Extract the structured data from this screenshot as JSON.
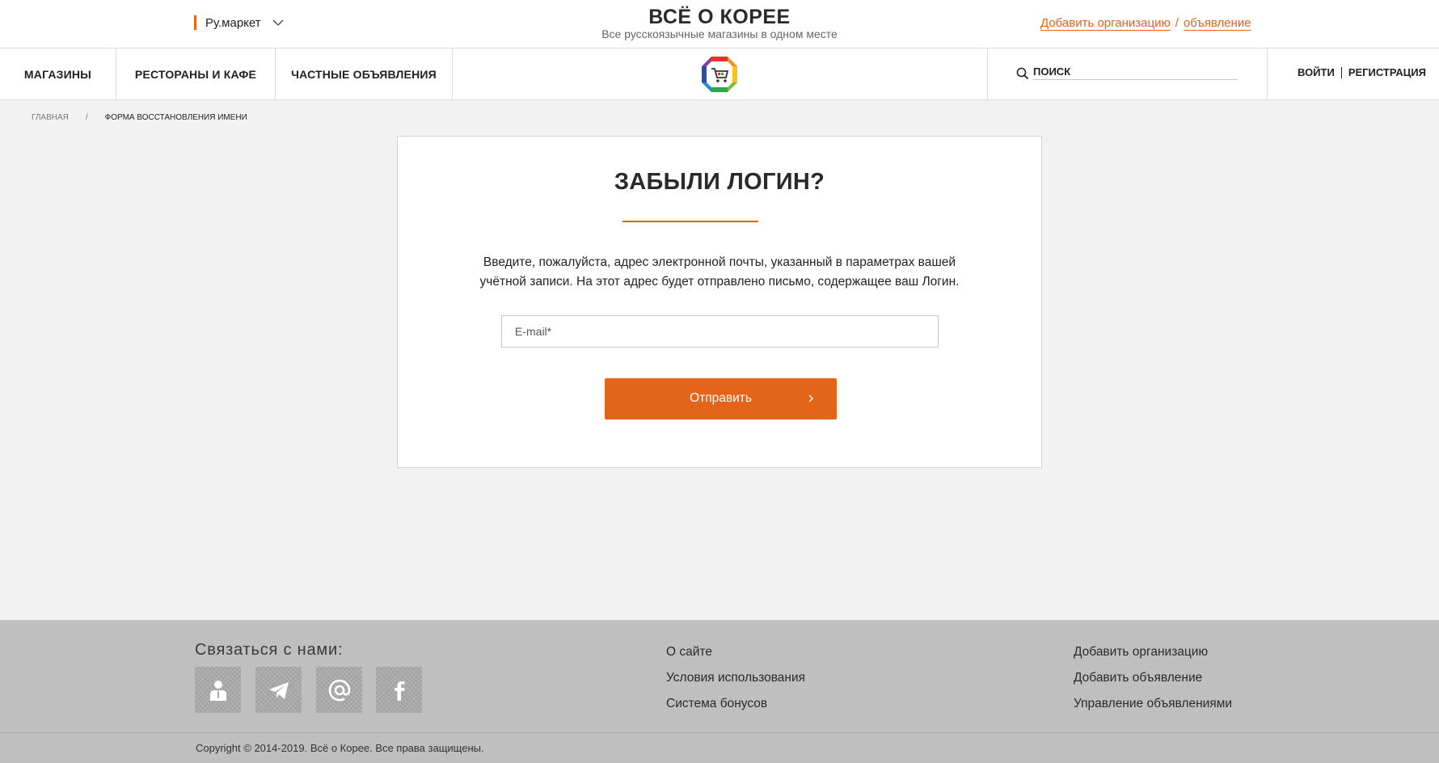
{
  "header": {
    "region": "Ру.маркет",
    "brand_title": "ВСЁ О КОРЕЕ",
    "brand_subtitle": "Все русскоязычные магазины в одном месте",
    "add_org": "Добавить организацию",
    "add_sep": "/",
    "add_ad": "объявление"
  },
  "nav": {
    "items": [
      {
        "label": "МАГАЗИНЫ"
      },
      {
        "label": "РЕСТОРАНЫ И КАФЕ"
      },
      {
        "label": "ЧАСТНЫЕ ОБЪЯВЛЕНИЯ"
      }
    ],
    "search_placeholder": "ПОИСК",
    "login": "ВОЙТИ",
    "register": "РЕГИСТРАЦИЯ"
  },
  "breadcrumb": {
    "home": "ГЛАВНАЯ",
    "separator": "/",
    "current": "ФОРМА ВОССТАНОВЛЕНИЯ ИМЕНИ"
  },
  "form": {
    "title": "ЗАБЫЛИ ЛОГИН?",
    "description": "Введите, пожалуйста, адрес электронной почты, указанный в параметрах вашей учётной записи. На этот адрес будет отправлено письмо, содержащее ваш Логин.",
    "email_placeholder": "E-mail*",
    "email_value": "",
    "submit_label": "Отправить"
  },
  "footer": {
    "contact_title": "Связаться с нами:",
    "social_icons": [
      "person-icon",
      "telegram-icon",
      "at-icon",
      "facebook-icon"
    ],
    "links_col1": [
      "О сайте",
      "Условия использования",
      "Система бонусов"
    ],
    "links_col2": [
      "Добавить организацию",
      "Добавить объявление",
      "Управление объявлениями"
    ],
    "copyright": "Copyright © 2014-2019. Всё о Корее. Все права защищены."
  },
  "colors": {
    "accent": "#e4641a",
    "footer_bg": "#bfbfbf",
    "page_bg": "#f2f2f2"
  }
}
